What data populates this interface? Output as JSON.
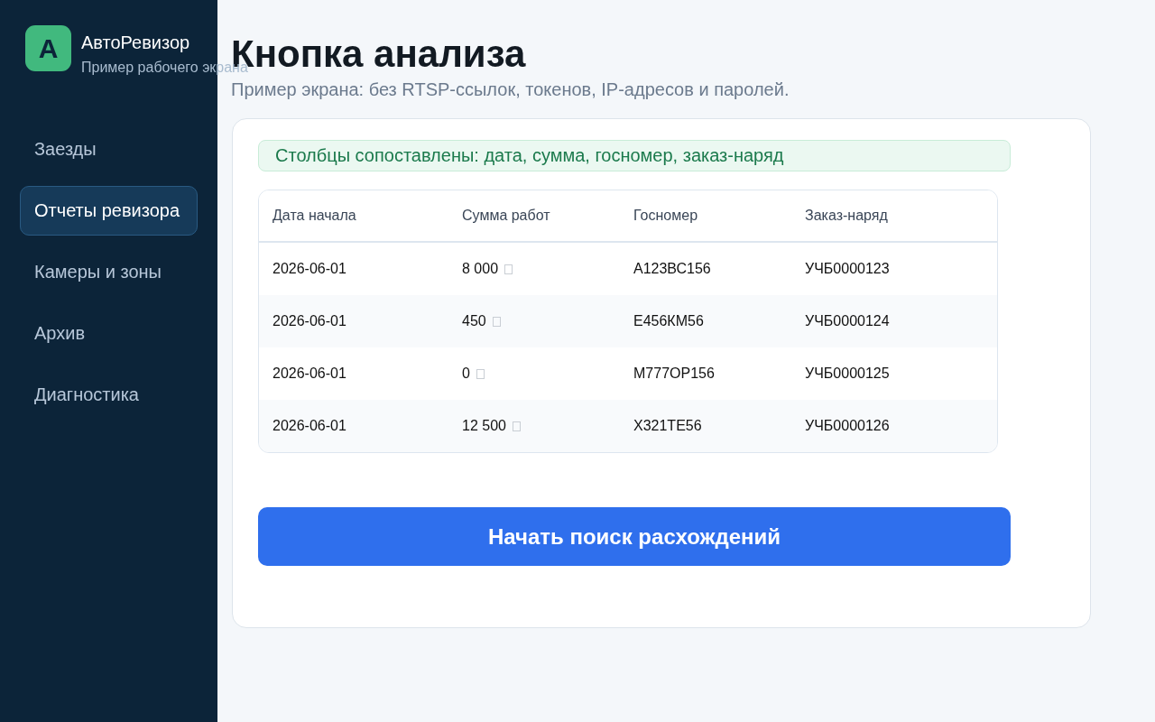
{
  "sidebar": {
    "logo_letter": "А",
    "app_name": "АвтоРевизор",
    "app_subtitle": "Пример рабочего экрана",
    "items": [
      {
        "label": "Заезды",
        "selected": false
      },
      {
        "label": "Отчеты ревизора",
        "selected": true
      },
      {
        "label": "Камеры и зоны",
        "selected": false
      },
      {
        "label": "Архив",
        "selected": false
      },
      {
        "label": "Диагностика",
        "selected": false
      }
    ]
  },
  "page": {
    "title": "Кнопка анализа",
    "subtitle": "Пример экрана: без RTSP-ссылок, токенов, IP-адресов и паролей."
  },
  "card": {
    "mapping_notice": "Столбцы сопоставлены: дата, сумма, госномер, заказ-наряд",
    "table": {
      "columns": [
        {
          "label": "Дата начала",
          "kind": "text"
        },
        {
          "label": "Сумма работ",
          "kind": "amount"
        },
        {
          "label": "Госномер",
          "kind": "text"
        },
        {
          "label": "Заказ-наряд",
          "kind": "text"
        }
      ],
      "rows": [
        [
          "2026-06-01",
          "8 000",
          "А123ВС156",
          "УЧБ0000123"
        ],
        [
          "2026-06-01",
          "450",
          "Е456КМ56",
          "УЧБ0000124"
        ],
        [
          "2026-06-01",
          "0",
          "М777ОР156",
          "УЧБ0000125"
        ],
        [
          "2026-06-01",
          "12 500",
          "Х321ТЕ56",
          "УЧБ0000126"
        ]
      ]
    },
    "primary_button": "Начать поиск расхождений"
  }
}
